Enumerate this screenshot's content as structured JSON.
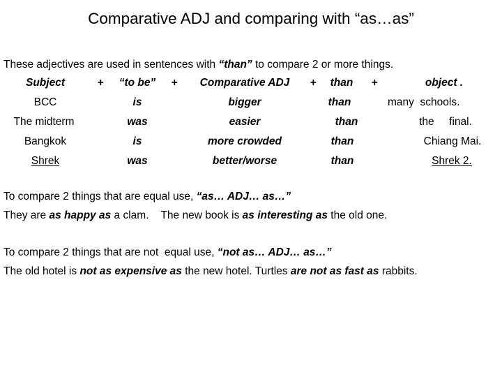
{
  "slide": {
    "title": "Comparative ADJ and comparing with “as…as”",
    "intro": {
      "before": "These adjectives are used in sentences with ",
      "emphasis": "“than”",
      "after": " to compare 2 or more things."
    }
  },
  "formula_table": {
    "header": {
      "subject": "Subject",
      "plus1": "+",
      "tobe": "“to be”",
      "plus2": "+",
      "adj": "Comparative ADJ",
      "plus3": "+",
      "than": "than",
      "plus4": "+",
      "object": "object ."
    },
    "rows": [
      {
        "subject": "BCC",
        "tobe": "is",
        "adj": "bigger",
        "than": "than",
        "object": "many  schools."
      },
      {
        "subject": "The midterm",
        "tobe": "was",
        "adj": "easier",
        "than": "than",
        "object": "the     final."
      },
      {
        "subject": "Bangkok",
        "tobe": "is",
        "adj": "more crowded",
        "than": "than",
        "object": "Chiang Mai."
      },
      {
        "subject": "Shrek",
        "tobe": "was",
        "adj": "better/worse",
        "than": "than",
        "object": "Shrek 2."
      }
    ]
  },
  "equal_section": {
    "rule_before": "To compare 2 things that are equal use, ",
    "rule_pattern": "“as… ADJ… as…”",
    "example_a_before": "They are ",
    "example_a_emphasis": "as happy as",
    "example_a_after": " a clam.    ",
    "example_b_before": "The new book is ",
    "example_b_emphasis": "as interesting as",
    "example_b_after": " the old one."
  },
  "not_equal_section": {
    "rule_before": "To compare 2 things that are not  equal use, ",
    "rule_pattern": "“not as… ADJ… as…”",
    "example_a_before": "The old hotel is ",
    "example_a_emphasis": "not as expensive as",
    "example_a_after": " the new hotel. ",
    "example_b_before": "Turtles ",
    "example_b_emphasis": "are not as fast as",
    "example_b_after": " rabbits."
  },
  "colors": {
    "background": "#ffffff",
    "text": "#000000"
  }
}
